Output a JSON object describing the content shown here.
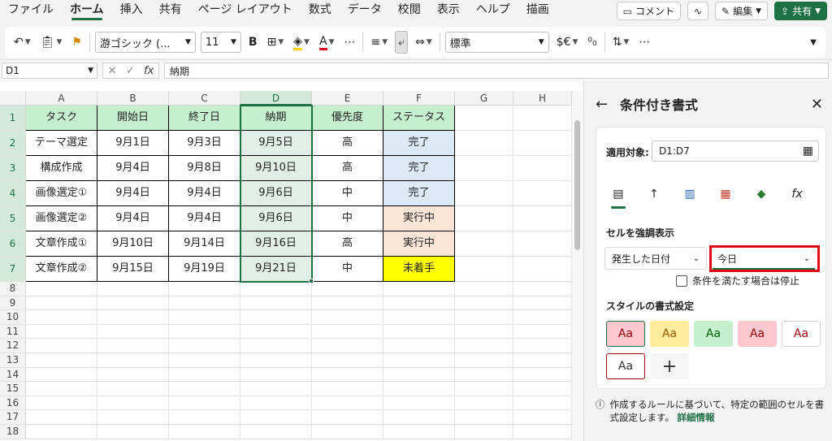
{
  "menu": {
    "tabs": [
      "ファイル",
      "ホーム",
      "挿入",
      "共有",
      "ページ レイアウト",
      "数式",
      "データ",
      "校閲",
      "表示",
      "ヘルプ",
      "描画"
    ],
    "active_tab": "ホーム",
    "comment_btn": "コメント",
    "edit_btn": "編集",
    "share_btn": "共有"
  },
  "ribbon": {
    "font_name": "游ゴシック (...",
    "font_size": "11",
    "number_format": "標準",
    "currency": "$€",
    "bold": "B"
  },
  "formula": {
    "name_box": "D1",
    "fx": "fx",
    "content": "納期"
  },
  "sheet": {
    "columns": [
      "A",
      "B",
      "C",
      "D",
      "E",
      "F",
      "G",
      "H"
    ],
    "selected_column": "D",
    "rows": [
      "1",
      "2",
      "3",
      "4",
      "5",
      "6",
      "7",
      "8",
      "9",
      "10",
      "11",
      "12",
      "13",
      "14",
      "15",
      "16",
      "17",
      "18"
    ],
    "table": [
      [
        "タスク",
        "開始日",
        "終了日",
        "納期",
        "優先度",
        "ステータス"
      ],
      [
        "テーマ選定",
        "9月1日",
        "9月3日",
        "9月5日",
        "高",
        "完了"
      ],
      [
        "構成作成",
        "9月4日",
        "9月8日",
        "9月10日",
        "高",
        "完了"
      ],
      [
        "画像選定①",
        "9月4日",
        "9月4日",
        "9月6日",
        "中",
        "完了"
      ],
      [
        "画像選定②",
        "9月4日",
        "9月4日",
        "9月6日",
        "中",
        "実行中"
      ],
      [
        "文章作成①",
        "9月10日",
        "9月14日",
        "9月16日",
        "高",
        "実行中"
      ],
      [
        "文章作成②",
        "9月15日",
        "9月19日",
        "9月21日",
        "中",
        "未着手"
      ]
    ],
    "colors": {
      "header_fill": "#c6efce",
      "selected_fill": "#e2efe6",
      "done_fill": "#dce9f7",
      "running_fill": "#fce4d6",
      "not_started_fill": "#ffff00"
    }
  },
  "pane": {
    "title": "条件付き書式",
    "apply_label": "適用対象:",
    "range": "D1:D7",
    "section_highlight": "セルを強調表示",
    "date_condition": "発生した日付",
    "date_value": "今日",
    "stop_label": "条件を満たす場合は停止",
    "style_section": "スタイルの書式設定",
    "swatch_text": "Aa",
    "add": "+",
    "footer_text": "作成するルールに基づいて、特定の範囲のセルを書式設定します。",
    "footer_link": "詳細情報",
    "highlight_color": "#e30613"
  }
}
